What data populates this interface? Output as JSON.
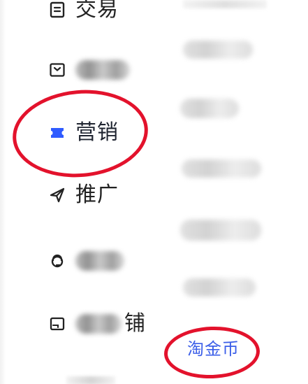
{
  "left_nav": {
    "items": [
      {
        "label": "交易",
        "icon": "trade-icon",
        "redacted": false,
        "active": false
      },
      {
        "label": "",
        "icon": "package-icon",
        "redacted": true,
        "active": false
      },
      {
        "label": "营销",
        "icon": "ticket-icon",
        "redacted": false,
        "active": true
      },
      {
        "label": "推广",
        "icon": "send-icon",
        "redacted": false,
        "active": false
      },
      {
        "label": "",
        "icon": "headset-icon",
        "redacted": true,
        "active": false
      },
      {
        "label": "铺",
        "icon": "store-icon",
        "redacted": true,
        "active": false
      }
    ]
  },
  "right_nav": {
    "visible_link": {
      "label": "淘金币",
      "color": "#3B5EE8"
    }
  },
  "colors": {
    "annotation_red": "#E3122C",
    "active_icon_blue": "#2F5BFF",
    "text_dark": "#222222"
  }
}
